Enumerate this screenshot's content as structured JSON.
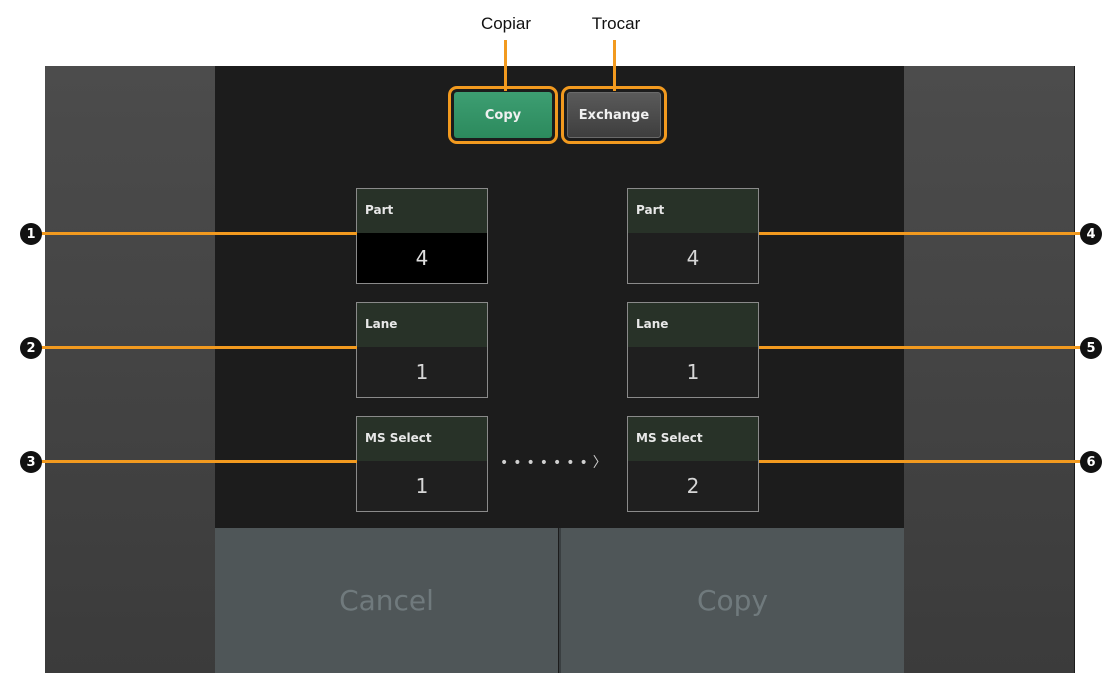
{
  "callouts": {
    "copy_label": "Copiar",
    "exchange_label": "Trocar",
    "markers": [
      "1",
      "2",
      "3",
      "4",
      "5",
      "6"
    ],
    "line_color": "#f29a1f"
  },
  "mode": {
    "copy_label": "Copy",
    "exchange_label": "Exchange",
    "active": "Copy",
    "active_color": "#2c8a5d"
  },
  "source": {
    "part": {
      "label": "Part",
      "value": "4"
    },
    "lane": {
      "label": "Lane",
      "value": "1"
    },
    "ms_select": {
      "label": "MS Select",
      "value": "1"
    }
  },
  "destination": {
    "part": {
      "label": "Part",
      "value": "4"
    },
    "lane": {
      "label": "Lane",
      "value": "1"
    },
    "ms_select": {
      "label": "MS Select",
      "value": "2"
    }
  },
  "arrow": "•••••••〉",
  "actions": {
    "cancel_label": "Cancel",
    "copy_label": "Copy"
  }
}
